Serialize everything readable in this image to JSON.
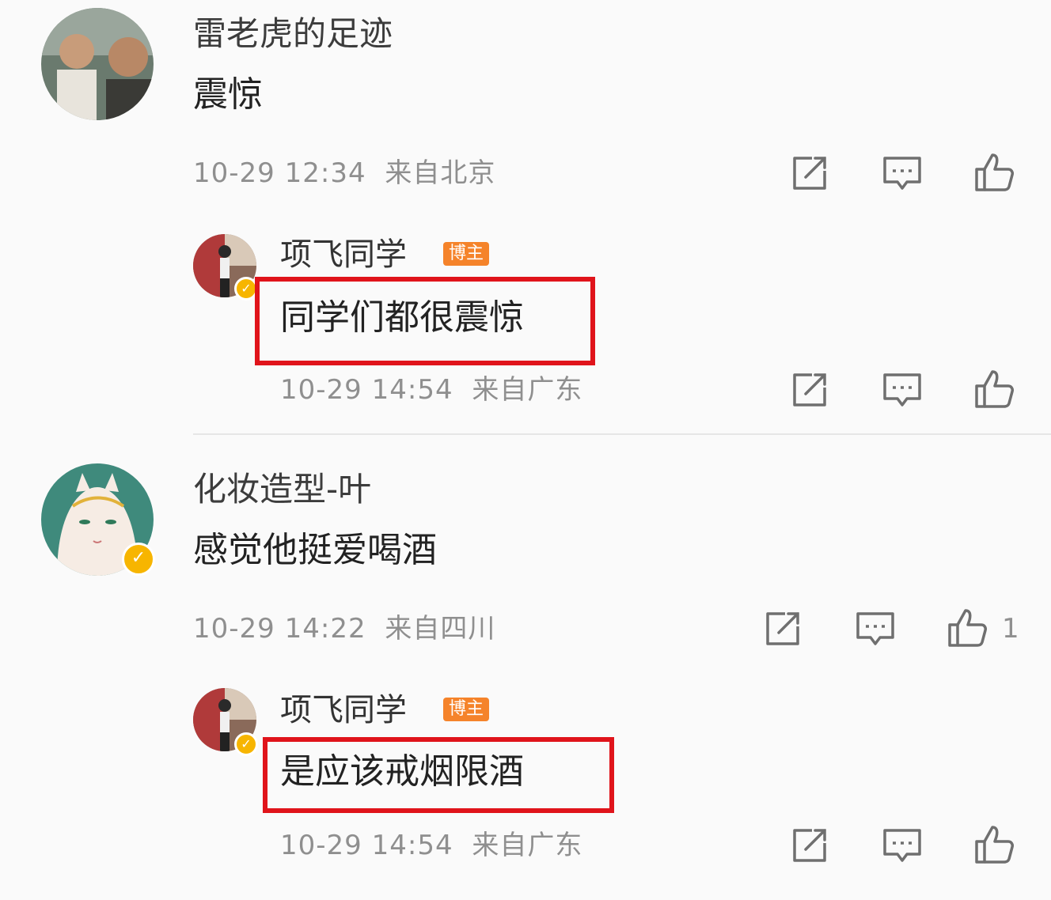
{
  "comments": [
    {
      "username": "雷老虎的足迹",
      "text": "震惊",
      "timestamp": "10-29 12:34",
      "location": "来自北京",
      "reply": {
        "username": "项飞同学",
        "badge": "博主",
        "text": "同学们都很震惊",
        "timestamp": "10-29 14:54",
        "location": "来自广东"
      }
    },
    {
      "username": "化妆造型-叶",
      "text": "感觉他挺爱喝酒",
      "timestamp": "10-29 14:22",
      "location": "来自四川",
      "like_count": "1",
      "reply": {
        "username": "项飞同学",
        "badge": "博主",
        "text": "是应该戒烟限酒",
        "timestamp": "10-29 14:54",
        "location": "来自广东"
      }
    }
  ],
  "icons": {
    "share": "share-icon",
    "comment": "comment-icon",
    "like": "thumbs-up-icon"
  },
  "colors": {
    "highlight": "#e0141b",
    "badge": "#f5832a",
    "verified": "#f7b500"
  }
}
